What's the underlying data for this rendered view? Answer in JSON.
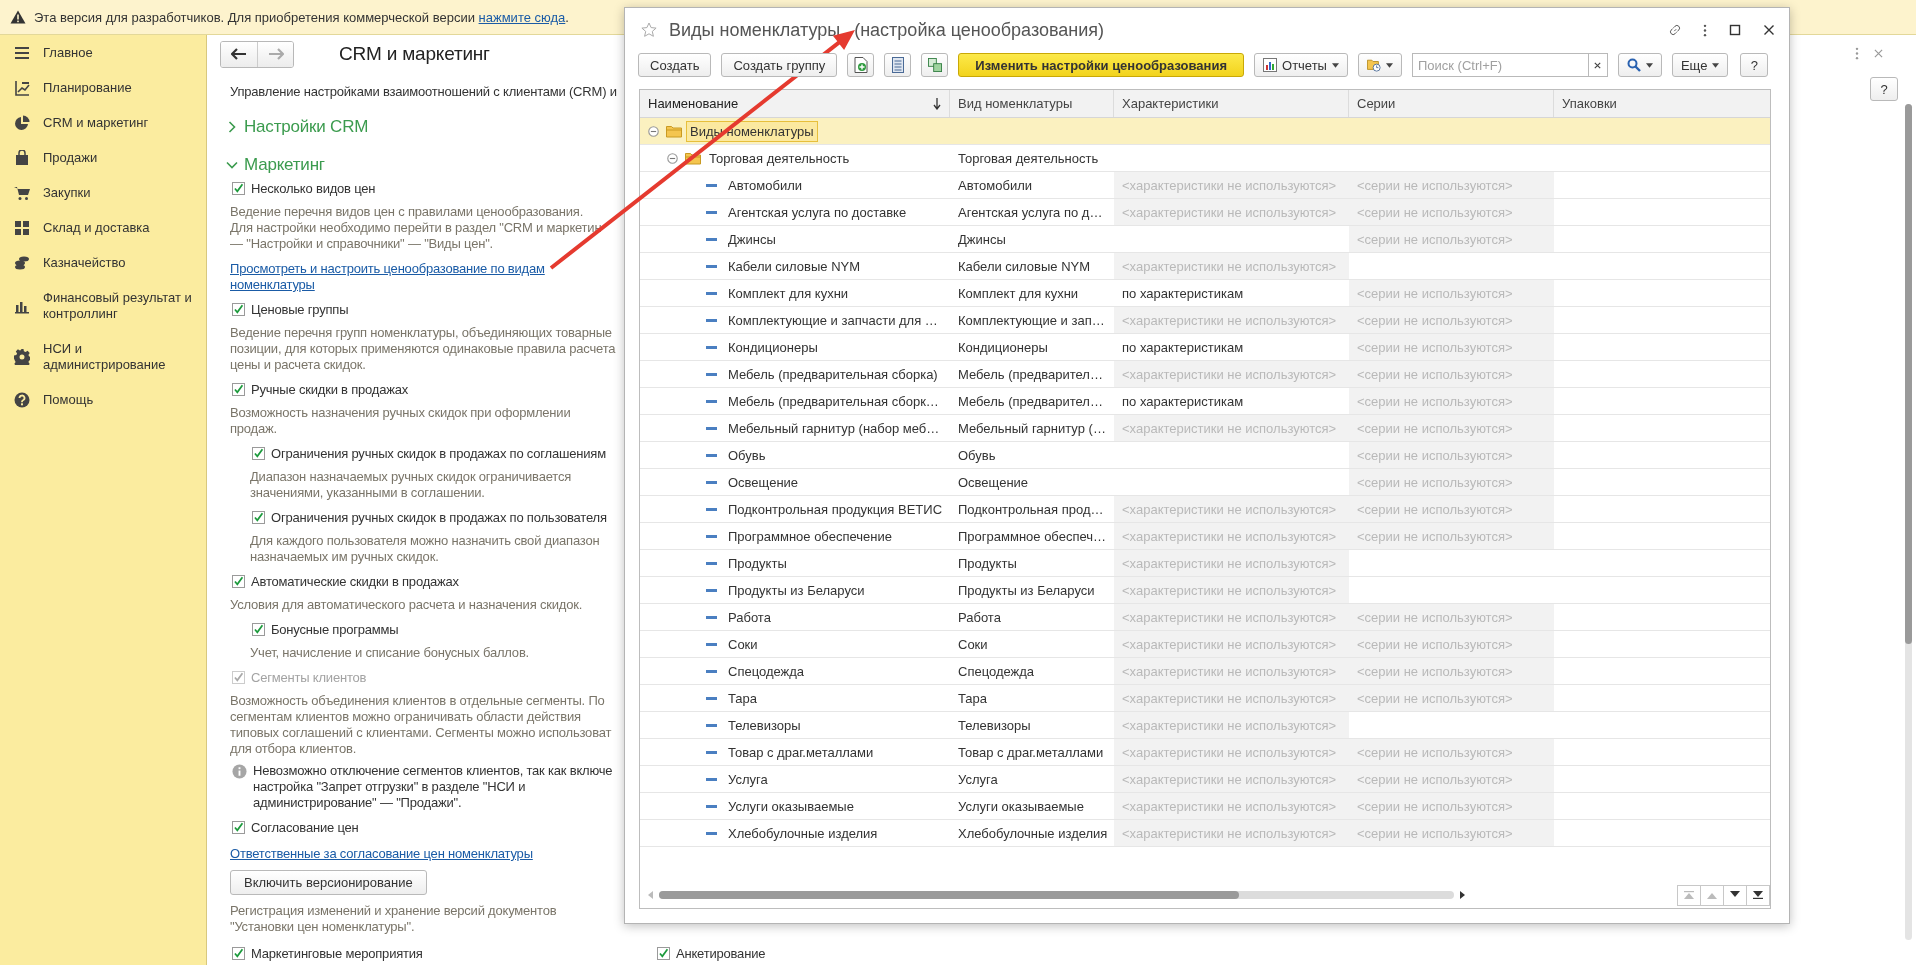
{
  "notice": {
    "text": "Эта версия для разработчиков. Для приобретения коммерческой версии",
    "link": "нажмите сюда",
    "tail": "."
  },
  "sidebar": {
    "items": [
      {
        "label": "Главное",
        "selected": false
      },
      {
        "label": "Планирование",
        "selected": false
      },
      {
        "label": "CRM и маркетинг",
        "selected": false
      },
      {
        "label": "Продажи",
        "selected": false
      },
      {
        "label": "Закупки",
        "selected": false
      },
      {
        "label": "Склад и доставка",
        "selected": false
      },
      {
        "label": "Казначейство",
        "selected": false
      },
      {
        "label": "Финансовый результат и\nконтроллинг",
        "selected": false
      },
      {
        "label": "НСИ и\nадминистрирование",
        "selected": false
      },
      {
        "label": "Помощь",
        "selected": false
      }
    ]
  },
  "page": {
    "title": "CRM и маркетинг",
    "subtitle": "Управление настройками взаимоотношений с клиентами (CRM) и",
    "help": "?",
    "sections": [
      {
        "title": "Настройки CRM",
        "expanded": false
      },
      {
        "title": "Маркетинг",
        "expanded": true,
        "items": [
          {
            "kind": "checkbox",
            "label": "Несколько видов цен",
            "checked": true,
            "disabled": false,
            "description": "Ведение перечня видов цен с правилами ценообразования.\nДля настройки необходимо перейти в раздел \"CRM и маркетин\n— \"Настройки и справочники\" — \"Виды цен\"."
          },
          {
            "kind": "link",
            "text": "Просмотреть и настроить ценообразование по видам\nноменклатуры"
          },
          {
            "kind": "checkbox",
            "label": "Ценовые группы",
            "checked": true,
            "disabled": false,
            "description": "Ведение перечня групп номенклатуры, объединяющих товарные\nпозиции, для которых применяются одинаковые правила расчета\nцены и расчета скидок."
          },
          {
            "kind": "checkbox",
            "label": "Ручные скидки в продажах",
            "checked": true,
            "disabled": false,
            "description": "Возможность назначения ручных скидок при оформлении\nпродаж.",
            "children": [
              {
                "kind": "checkbox",
                "label": "Ограничения ручных скидок в продажах по соглашениям",
                "checked": true,
                "disabled": false,
                "description": "Диапазон назначаемых ручных скидок ограничивается\nзначениями, указанными в соглашении."
              },
              {
                "kind": "checkbox",
                "label": "Ограничения ручных скидок в продажах по пользователя",
                "checked": true,
                "disabled": false,
                "description": "Для каждого пользователя можно назначить свой диапазон\nназначаемых им ручных скидок."
              }
            ]
          },
          {
            "kind": "checkbox",
            "label": "Автоматические скидки в продажах",
            "checked": true,
            "disabled": false,
            "description": "Условия для автоматического расчета и назначения скидок.",
            "children": [
              {
                "kind": "checkbox",
                "label": "Бонусные программы",
                "checked": true,
                "disabled": false,
                "description": "Учет, начисление и списание бонусных баллов."
              }
            ]
          },
          {
            "kind": "checkbox",
            "label": "Сегменты клиентов",
            "checked": true,
            "disabled": true,
            "description": "Возможность объединения клиентов в отдельные сегменты. По\nсегментам клиентов можно ограничивать области действия\nтиповых соглашений с клиентами. Сегменты можно использоват\nдля отбора клиентов."
          },
          {
            "kind": "info",
            "text": "Невозможно отключение сегментов клиентов, так как включе\nнастройка \"Запрет отгрузки\" в разделе \"НСИ и\nадминистрирование\" — \"Продажи\"."
          },
          {
            "kind": "checkbox",
            "label": "Согласование цен",
            "checked": true,
            "disabled": false
          },
          {
            "kind": "link",
            "text": "Ответственные за согласование цен номенклатуры"
          },
          {
            "kind": "button",
            "label": "Включить версионирование",
            "description": "Регистрация изменений и хранение версий документов\n\"Установки цен номенклатуры\"."
          },
          {
            "kind": "pair",
            "items": [
              {
                "kind": "checkbox",
                "label": "Маркетинговые мероприятия",
                "checked": true,
                "disabled": false
              },
              {
                "kind": "checkbox",
                "label": "Анкетирование",
                "checked": true,
                "disabled": false
              }
            ]
          }
        ]
      }
    ]
  },
  "dialog": {
    "title": "Виды номенклатуры",
    "subtitle": "(настройка ценообразования)",
    "toolbar": {
      "create": "Создать",
      "create_group": "Создать группу",
      "primary": "Изменить настройки ценообразования",
      "reports": "Отчеты",
      "more": "Еще",
      "help": "?"
    },
    "search": {
      "placeholder": "Поиск (Ctrl+F)"
    },
    "table": {
      "columns": [
        {
          "label": "Наименование",
          "sorted": true
        },
        {
          "label": "Вид номенклатуры",
          "sorted": false
        },
        {
          "label": "Характеристики",
          "sorted": false
        },
        {
          "label": "Серии",
          "sorted": false
        },
        {
          "label": "Упаковки",
          "sorted": false
        }
      ],
      "rows": [
        {
          "kind": "group",
          "name": "Виды номенклатуры",
          "selected": true,
          "expanded": true,
          "children": [
            {
              "kind": "group",
              "name": "Торговая деятельность",
              "type": "Торговая деятельность",
              "selected": false,
              "expanded": true,
              "children": [
                {
                  "kind": "item",
                  "name": "Автомобили",
                  "type": "Автомобили",
                  "characteristics": {
                    "text": "<характеристики не используются>",
                    "unused": true
                  },
                  "series": {
                    "text": "<серии не используются>",
                    "unused": true
                  },
                  "selected": false
                },
                {
                  "kind": "item",
                  "name": "Агентская услуга по доставке",
                  "type": "Агентская услуга по д…",
                  "characteristics": {
                    "text": "<характеристики не используются>",
                    "unused": true
                  },
                  "series": {
                    "text": "<серии не используются>",
                    "unused": true
                  },
                  "selected": false
                },
                {
                  "kind": "item",
                  "name": "Джинсы",
                  "type": "Джинсы",
                  "series": {
                    "text": "<серии не используются>",
                    "unused": true
                  },
                  "selected": false
                },
                {
                  "kind": "item",
                  "name": "Кабели силовые NYM",
                  "type": "Кабели силовые NYM",
                  "characteristics": {
                    "text": "<характеристики не используются>",
                    "unused": true
                  },
                  "selected": false
                },
                {
                  "kind": "item",
                  "name": "Комплект для кухни",
                  "type": "Комплект для кухни",
                  "characteristics": {
                    "text": "по характеристикам",
                    "unused": false
                  },
                  "series": {
                    "text": "<серии не используются>",
                    "unused": true
                  },
                  "selected": false
                },
                {
                  "kind": "item",
                  "name": "Комплектующие и запчасти для …",
                  "type": "Комплектующие и зап…",
                  "characteristics": {
                    "text": "<характеристики не используются>",
                    "unused": true
                  },
                  "series": {
                    "text": "<серии не используются>",
                    "unused": true
                  },
                  "selected": false
                },
                {
                  "kind": "item",
                  "name": "Кондиционеры",
                  "type": "Кондиционеры",
                  "characteristics": {
                    "text": "по характеристикам",
                    "unused": false
                  },
                  "series": {
                    "text": "<серии не используются>",
                    "unused": true
                  },
                  "selected": false
                },
                {
                  "kind": "item",
                  "name": "Мебель (предварительная сборка)",
                  "type": "Мебель (предварител…",
                  "characteristics": {
                    "text": "<характеристики не используются>",
                    "unused": true
                  },
                  "series": {
                    "text": "<серии не используются>",
                    "unused": true
                  },
                  "selected": false
                },
                {
                  "kind": "item",
                  "name": "Мебель (предварительная сборк…",
                  "type": "Мебель (предварител…",
                  "characteristics": {
                    "text": "по характеристикам",
                    "unused": false
                  },
                  "series": {
                    "text": "<серии не используются>",
                    "unused": true
                  },
                  "selected": false
                },
                {
                  "kind": "item",
                  "name": "Мебельный гарнитур (набор меб…",
                  "type": "Мебельный гарнитур (…",
                  "characteristics": {
                    "text": "<характеристики не используются>",
                    "unused": true
                  },
                  "series": {
                    "text": "<серии не используются>",
                    "unused": true
                  },
                  "selected": false
                },
                {
                  "kind": "item",
                  "name": "Обувь",
                  "type": "Обувь",
                  "series": {
                    "text": "<серии не используются>",
                    "unused": true
                  },
                  "selected": false
                },
                {
                  "kind": "item",
                  "name": "Освещение",
                  "type": "Освещение",
                  "series": {
                    "text": "<серии не используются>",
                    "unused": true
                  },
                  "selected": false
                },
                {
                  "kind": "item",
                  "name": "Подконтрольная продукция ВЕТИС",
                  "type": "Подконтрольная прод…",
                  "characteristics": {
                    "text": "<характеристики не используются>",
                    "unused": true
                  },
                  "series": {
                    "text": "<серии не используются>",
                    "unused": true
                  },
                  "selected": false
                },
                {
                  "kind": "item",
                  "name": "Программное обеспечение",
                  "type": "Программное обеспеч…",
                  "characteristics": {
                    "text": "<характеристики не используются>",
                    "unused": true
                  },
                  "series": {
                    "text": "<серии не используются>",
                    "unused": true
                  },
                  "selected": false
                },
                {
                  "kind": "item",
                  "name": "Продукты",
                  "type": "Продукты",
                  "characteristics": {
                    "text": "<характеристики не используются>",
                    "unused": true
                  },
                  "selected": false
                },
                {
                  "kind": "item",
                  "name": "Продукты из Беларуси",
                  "type": "Продукты из Беларуси",
                  "characteristics": {
                    "text": "<характеристики не используются>",
                    "unused": true
                  },
                  "selected": false
                },
                {
                  "kind": "item",
                  "name": "Работа",
                  "type": "Работа",
                  "characteristics": {
                    "text": "<характеристики не используются>",
                    "unused": true
                  },
                  "series": {
                    "text": "<серии не используются>",
                    "unused": true
                  },
                  "selected": false
                },
                {
                  "kind": "item",
                  "name": "Соки",
                  "type": "Соки",
                  "characteristics": {
                    "text": "<характеристики не используются>",
                    "unused": true
                  },
                  "series": {
                    "text": "<серии не используются>",
                    "unused": true
                  },
                  "selected": false
                },
                {
                  "kind": "item",
                  "name": "Спецодежда",
                  "type": "Спецодежда",
                  "characteristics": {
                    "text": "<характеристики не используются>",
                    "unused": true
                  },
                  "series": {
                    "text": "<серии не используются>",
                    "unused": true
                  },
                  "selected": false
                },
                {
                  "kind": "item",
                  "name": "Тара",
                  "type": "Тара",
                  "characteristics": {
                    "text": "<характеристики не используются>",
                    "unused": true
                  },
                  "series": {
                    "text": "<серии не используются>",
                    "unused": true
                  },
                  "selected": false
                },
                {
                  "kind": "item",
                  "name": "Телевизоры",
                  "type": "Телевизоры",
                  "characteristics": {
                    "text": "<характеристики не используются>",
                    "unused": true
                  },
                  "selected": false
                },
                {
                  "kind": "item",
                  "name": "Товар с драг.металлами",
                  "type": "Товар с драг.металлами",
                  "characteristics": {
                    "text": "<характеристики не используются>",
                    "unused": true
                  },
                  "series": {
                    "text": "<серии не используются>",
                    "unused": true
                  },
                  "selected": false
                },
                {
                  "kind": "item",
                  "name": "Услуга",
                  "type": "Услуга",
                  "characteristics": {
                    "text": "<характеристики не используются>",
                    "unused": true
                  },
                  "series": {
                    "text": "<серии не используются>",
                    "unused": true
                  },
                  "selected": false
                },
                {
                  "kind": "item",
                  "name": "Услуги оказываемые",
                  "type": "Услуги оказываемые",
                  "characteristics": {
                    "text": "<характеристики не используются>",
                    "unused": true
                  },
                  "series": {
                    "text": "<серии не используются>",
                    "unused": true
                  },
                  "selected": false
                },
                {
                  "kind": "item",
                  "name": "Хлебобулочные изделия",
                  "type": "Хлебобулочные изделия",
                  "characteristics": {
                    "text": "<характеристики не используются>",
                    "unused": true
                  },
                  "series": {
                    "text": "<серии не используются>",
                    "unused": true
                  },
                  "selected": false
                }
              ]
            }
          ]
        }
      ]
    }
  }
}
